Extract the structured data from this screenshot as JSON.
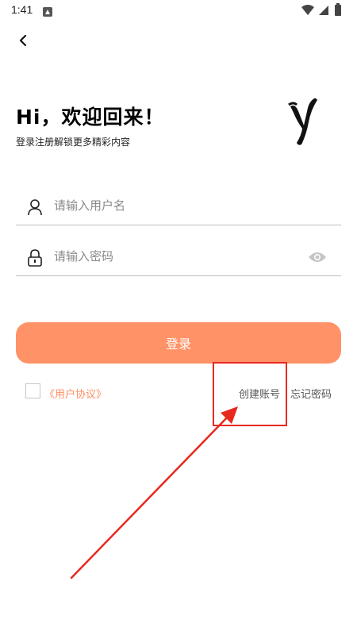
{
  "status_bar": {
    "time": "1:41",
    "icons": [
      "notification-app-icon",
      "wifi-icon",
      "signal-icon",
      "battery-icon"
    ]
  },
  "header": {
    "back_icon": "chevron-left-icon"
  },
  "welcome": {
    "title": "Hi，欢迎回来！",
    "subtitle": "登录注册解锁更多精彩内容",
    "logo_icon": "brush-y-logo"
  },
  "form": {
    "username": {
      "placeholder": "请输入用户名",
      "value": "",
      "icon": "user-icon"
    },
    "password": {
      "placeholder": "请输入密码",
      "value": "",
      "icon": "lock-icon",
      "toggle_icon": "eye-icon"
    }
  },
  "actions": {
    "login_label": "登录",
    "agreement_checked": false,
    "agreement_label": "《用户协议》",
    "create_account_label": "创建账号",
    "forgot_password_label": "忘记密码"
  },
  "colors": {
    "accent": "#ff9266",
    "link_accent": "#ff8f63",
    "annotation": "#e8281e"
  }
}
